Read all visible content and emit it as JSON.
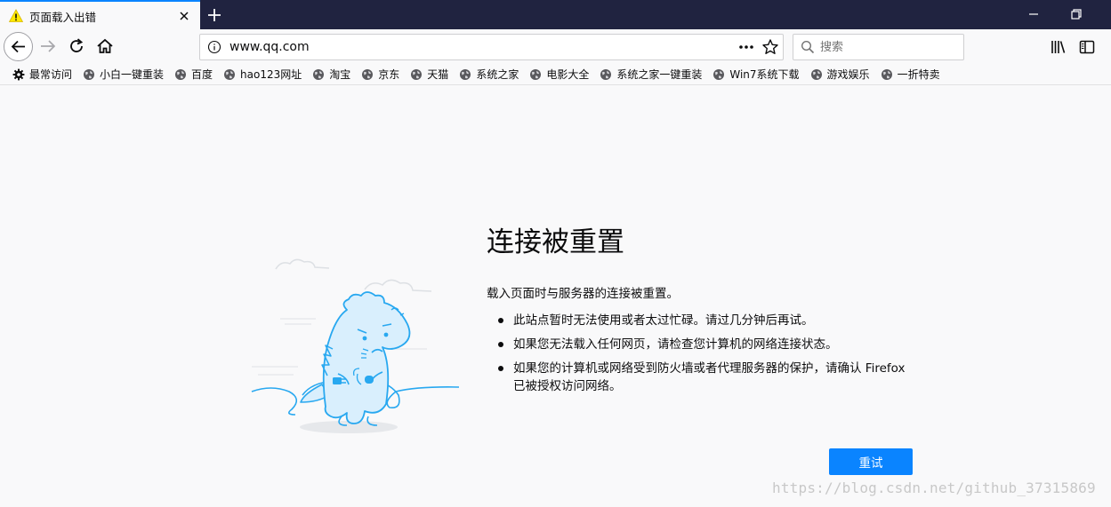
{
  "tab": {
    "title": "页面载入出错",
    "icon": "warning-icon"
  },
  "colors": {
    "accent": "#0a84ff",
    "tabstrip": "#202340",
    "page_bg": "#f9f9fa",
    "illustration": "#28a8f0"
  },
  "urlbar": {
    "url": "www.qq.com"
  },
  "search": {
    "placeholder": "搜索"
  },
  "bookmarks": [
    {
      "label": "最常访问",
      "icon": "gear-icon"
    },
    {
      "label": "小白一键重装",
      "icon": "globe-icon"
    },
    {
      "label": "百度",
      "icon": "globe-icon"
    },
    {
      "label": "hao123网址",
      "icon": "globe-icon"
    },
    {
      "label": "淘宝",
      "icon": "globe-icon"
    },
    {
      "label": "京东",
      "icon": "globe-icon"
    },
    {
      "label": "天猫",
      "icon": "globe-icon"
    },
    {
      "label": "系统之家",
      "icon": "globe-icon"
    },
    {
      "label": "电影大全",
      "icon": "globe-icon"
    },
    {
      "label": "系统之家一键重装",
      "icon": "globe-icon"
    },
    {
      "label": "Win7系统下载",
      "icon": "globe-icon"
    },
    {
      "label": "游戏娱乐",
      "icon": "globe-icon"
    },
    {
      "label": "一折特卖",
      "icon": "globe-icon"
    }
  ],
  "error": {
    "title": "连接被重置",
    "description": "载入页面时与服务器的连接被重置。",
    "items": [
      "此站点暂时无法使用或者太过忙碌。请过几分钟后再试。",
      "如果您无法载入任何网页，请检查您计算机的网络连接状态。",
      "如果您的计算机或网络受到防火墙或者代理服务器的保护，请确认 Firefox 已被授权访问网络。"
    ],
    "retry_label": "重试"
  },
  "watermark": "https://blog.csdn.net/github_37315869"
}
